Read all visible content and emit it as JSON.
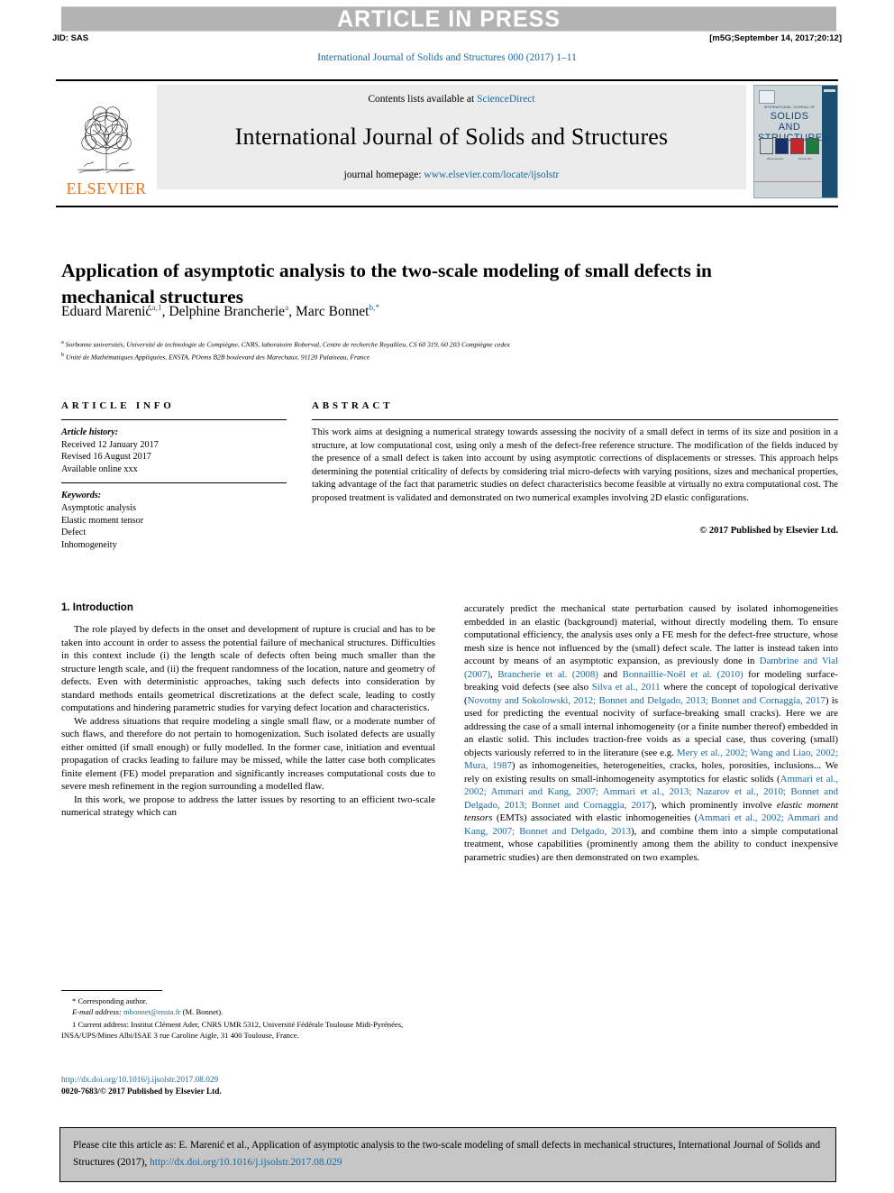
{
  "banner": {
    "press_label": "ARTICLE IN PRESS",
    "jid": "JID: SAS",
    "stamp": "[m5G;September 14, 2017;20:12]"
  },
  "running_head": "International Journal of Solids and Structures 000 (2017) 1–11",
  "masthead": {
    "publisher_name": "ELSEVIER",
    "contents_prefix": "Contents lists available at ",
    "contents_link": "ScienceDirect",
    "journal_title": "International Journal of Solids and Structures",
    "homepage_prefix": "journal homepage: ",
    "homepage_link": "www.elsevier.com/locate/ijsolstr",
    "cover": {
      "top_label": "INTERNATIONAL JOURNAL OF",
      "line1": "SOLIDS AND",
      "line2": "STRUCTURES",
      "caption_left": "Brian Amadio",
      "caption_right": "Davide Hill"
    }
  },
  "article": {
    "title": "Application of asymptotic analysis to the two-scale modeling of small defects in mechanical structures",
    "authors_html": "Eduard Marenić<sup>a,1</sup>, Delphine Brancherie<sup>a</sup>, Marc Bonnet<sup>b,*</sup>",
    "affiliation_a": "Sorbonne universités, Université de technologie de Compiègne, CNRS, laboratoire Roberval, Centre de recherche Royallieu, CS 60 319, 60 203 Compiègne cedex",
    "affiliation_b": "Unité de Mathématiques Appliquées, ENSTA, POems B2B boulevard des Marechaux, 91120 Palaiseau, France"
  },
  "article_info": {
    "heading": "ARTICLE INFO",
    "history_label": "Article history:",
    "history": [
      "Received 12 January 2017",
      "Revised 16 August 2017",
      "Available online xxx"
    ],
    "keywords_label": "Keywords:",
    "keywords": [
      "Asymptotic analysis",
      "Elastic moment tensor",
      "Defect",
      "Inhomogeneity"
    ]
  },
  "abstract": {
    "heading": "ABSTRACT",
    "text": "This work aims at designing a numerical strategy towards assessing the nocivity of a small defect in terms of its size and position in a structure, at low computational cost, using only a mesh of the defect-free reference structure. The modification of the fields induced by the presence of a small defect is taken into account by using asymptotic corrections of displacements or stresses. This approach helps determining the potential criticality of defects by considering trial micro-defects with varying positions, sizes and mechanical properties, taking advantage of the fact that parametric studies on defect characteristics become feasible at virtually no extra computational cost. The proposed treatment is validated and demonstrated on two numerical examples involving 2D elastic configurations.",
    "copyright": "© 2017 Published by Elsevier Ltd."
  },
  "body": {
    "section_heading": "1. Introduction",
    "left_paragraphs": [
      "The role played by defects in the onset and development of rupture is crucial and has to be taken into account in order to assess the potential failure of mechanical structures. Difficulties in this context include (i) the length scale of defects often being much smaller than the structure length scale, and (ii) the frequent randomness of the location, nature and geometry of defects. Even with deterministic approaches, taking such defects into consideration by standard methods entails geometrical discretizations at the defect scale, leading to costly computations and hindering parametric studies for varying defect location and characteristics.",
      "We address situations that require modeling a single small flaw, or a moderate number of such flaws, and therefore do not pertain to homogenization. Such isolated defects are usually either omitted (if small enough) or fully modelled. In the former case, initiation and eventual propagation of cracks leading to failure may be missed, while the latter case both complicates finite element (FE) model preparation and significantly increases computational costs due to severe mesh refinement in the region surrounding a modelled flaw.",
      "In this work, we propose to address the latter issues by resorting to an efficient two-scale numerical strategy which can"
    ],
    "right_paragraph_runs": [
      {
        "t": "accurately predict the mechanical state perturbation caused by isolated inhomogeneities embedded in an elastic (background) material, without directly modeling them. To ensure computational efficiency, the analysis uses only a FE mesh for the defect-free structure, whose mesh size is hence not influenced by the (small) defect scale. The latter is instead taken into account by means of an asymptotic expansion, as previously done in ",
        "k": "plain"
      },
      {
        "t": "Dambrine and Vial (2007)",
        "k": "ref"
      },
      {
        "t": ", ",
        "k": "plain"
      },
      {
        "t": "Brancherie et al. (2008)",
        "k": "ref"
      },
      {
        "t": " and ",
        "k": "plain"
      },
      {
        "t": "Bonnaillie-Noël et al. (2010)",
        "k": "ref"
      },
      {
        "t": " for modeling surface-breaking void defects (see also ",
        "k": "plain"
      },
      {
        "t": "Silva et al., 2011",
        "k": "ref"
      },
      {
        "t": " where the concept of topological derivative (",
        "k": "plain"
      },
      {
        "t": "Novotny and Sokolowski, 2012; Bonnet and Delgado, 2013; Bonnet and Cornaggia, 2017",
        "k": "ref"
      },
      {
        "t": ") is used for predicting the eventual nocivity of surface-breaking small cracks). Here we are addressing the case of a small internal inhomogeneity (or a finite number thereof) embedded in an elastic solid. This includes traction-free voids as a special case, thus covering (small) objects variously referred to in the literature (see e.g. ",
        "k": "plain"
      },
      {
        "t": "Mery et al., 2002; Wang and Liao, 2002; Mura, 1987",
        "k": "ref"
      },
      {
        "t": ") as inhomogeneities, heterogeneities, cracks, holes, porosities, inclusions... We rely on existing results on small-inhomogeneity asymptotics for elastic solids (",
        "k": "plain"
      },
      {
        "t": "Ammari et al., 2002; Ammari and Kang, 2007; Ammari et al., 2013; Nazarov et al., 2010; Bonnet and Delgado, 2013; Bonnet and Cornaggia, 2017",
        "k": "ref"
      },
      {
        "t": "), which prominently involve ",
        "k": "plain"
      },
      {
        "t": "elastic moment tensors",
        "k": "italic"
      },
      {
        "t": " (EMTs) associated with elastic inhomogeneities (",
        "k": "plain"
      },
      {
        "t": "Ammari et al., 2002; Ammari and Kang, 2007; Bonnet and Delgado, 2013",
        "k": "ref"
      },
      {
        "t": "), and combine them into a simple computational treatment, whose capabilities (prominently among them the ability to conduct inexpensive parametric studies) are then demonstrated on two examples.",
        "k": "plain"
      }
    ]
  },
  "footnotes": {
    "corresponding": "* Corresponding author.",
    "email_label": "E-mail address: ",
    "email": "mbonnet@ensta.fr",
    "email_suffix": " (M. Bonnet).",
    "current_address": "1 Current address: Institut Clément Ader, CNRS UMR 5312, Université Fédérale Toulouse Midi-Pyrénées, INSA/UPS/Mines Albi/ISAE 3 rue Caroline Aigle, 31 400 Toulouse, France."
  },
  "doi_block": {
    "doi_url": "http://dx.doi.org/10.1016/j.ijsolstr.2017.08.029",
    "issn_line": "0020-7683/© 2017 Published by Elsevier Ltd."
  },
  "citation_footer": {
    "text_before": "Please cite this article as: E. Marenić et al., Application of asymptotic analysis to the two-scale modeling of small defects in mechanical structures, International Journal of Solids and Structures (2017), ",
    "link": "http://dx.doi.org/10.1016/j.ijsolstr.2017.08.029"
  }
}
